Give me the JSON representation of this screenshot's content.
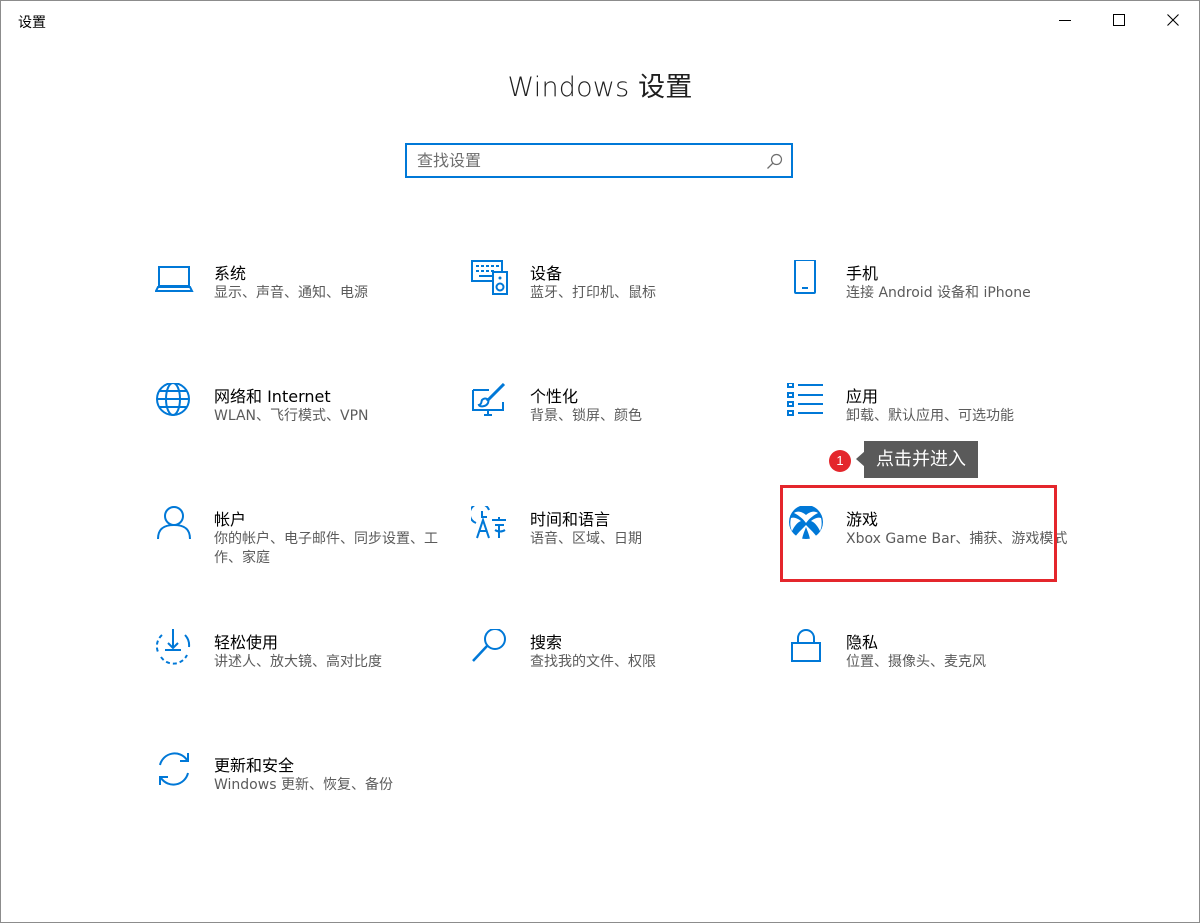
{
  "window": {
    "title": "设置",
    "controls": {
      "minimize_icon": "minimize-icon",
      "maximize_icon": "maximize-icon",
      "close_icon": "close-icon"
    }
  },
  "header": {
    "title": "Windows 设置"
  },
  "search": {
    "placeholder": "查找设置",
    "value": "",
    "icon": "search-icon"
  },
  "accent_color": "#0078d7",
  "tiles": [
    {
      "id": "system",
      "name": "系统",
      "desc": "显示、声音、通知、电源",
      "icon": "laptop-icon"
    },
    {
      "id": "devices",
      "name": "设备",
      "desc": "蓝牙、打印机、鼠标",
      "icon": "keyboard-speaker-icon"
    },
    {
      "id": "phone",
      "name": "手机",
      "desc": "连接 Android 设备和 iPhone",
      "icon": "phone-icon"
    },
    {
      "id": "network",
      "name": "网络和 Internet",
      "desc": "WLAN、飞行模式、VPN",
      "icon": "globe-icon"
    },
    {
      "id": "personalization",
      "name": "个性化",
      "desc": "背景、锁屏、颜色",
      "icon": "paint-brush-icon"
    },
    {
      "id": "apps",
      "name": "应用",
      "desc": "卸载、默认应用、可选功能",
      "icon": "app-list-icon"
    },
    {
      "id": "accounts",
      "name": "帐户",
      "desc": "你的帐户、电子邮件、同步设置、工作、家庭",
      "icon": "person-icon"
    },
    {
      "id": "time-language",
      "name": "时间和语言",
      "desc": "语音、区域、日期",
      "icon": "clock-language-icon"
    },
    {
      "id": "gaming",
      "name": "游戏",
      "desc": "Xbox Game Bar、捕获、游戏模式",
      "icon": "xbox-icon"
    },
    {
      "id": "ease-of-access",
      "name": "轻松使用",
      "desc": "讲述人、放大镜、高对比度",
      "icon": "ease-of-access-icon"
    },
    {
      "id": "search",
      "name": "搜索",
      "desc": "查找我的文件、权限",
      "icon": "magnifier-icon"
    },
    {
      "id": "privacy",
      "name": "隐私",
      "desc": "位置、摄像头、麦克风",
      "icon": "lock-icon"
    },
    {
      "id": "update-security",
      "name": "更新和安全",
      "desc": "Windows 更新、恢复、备份",
      "icon": "sync-arrows-icon"
    }
  ],
  "annotation": {
    "step_number": "1",
    "text": "点击并进入",
    "highlight_color": "#e4262c"
  }
}
